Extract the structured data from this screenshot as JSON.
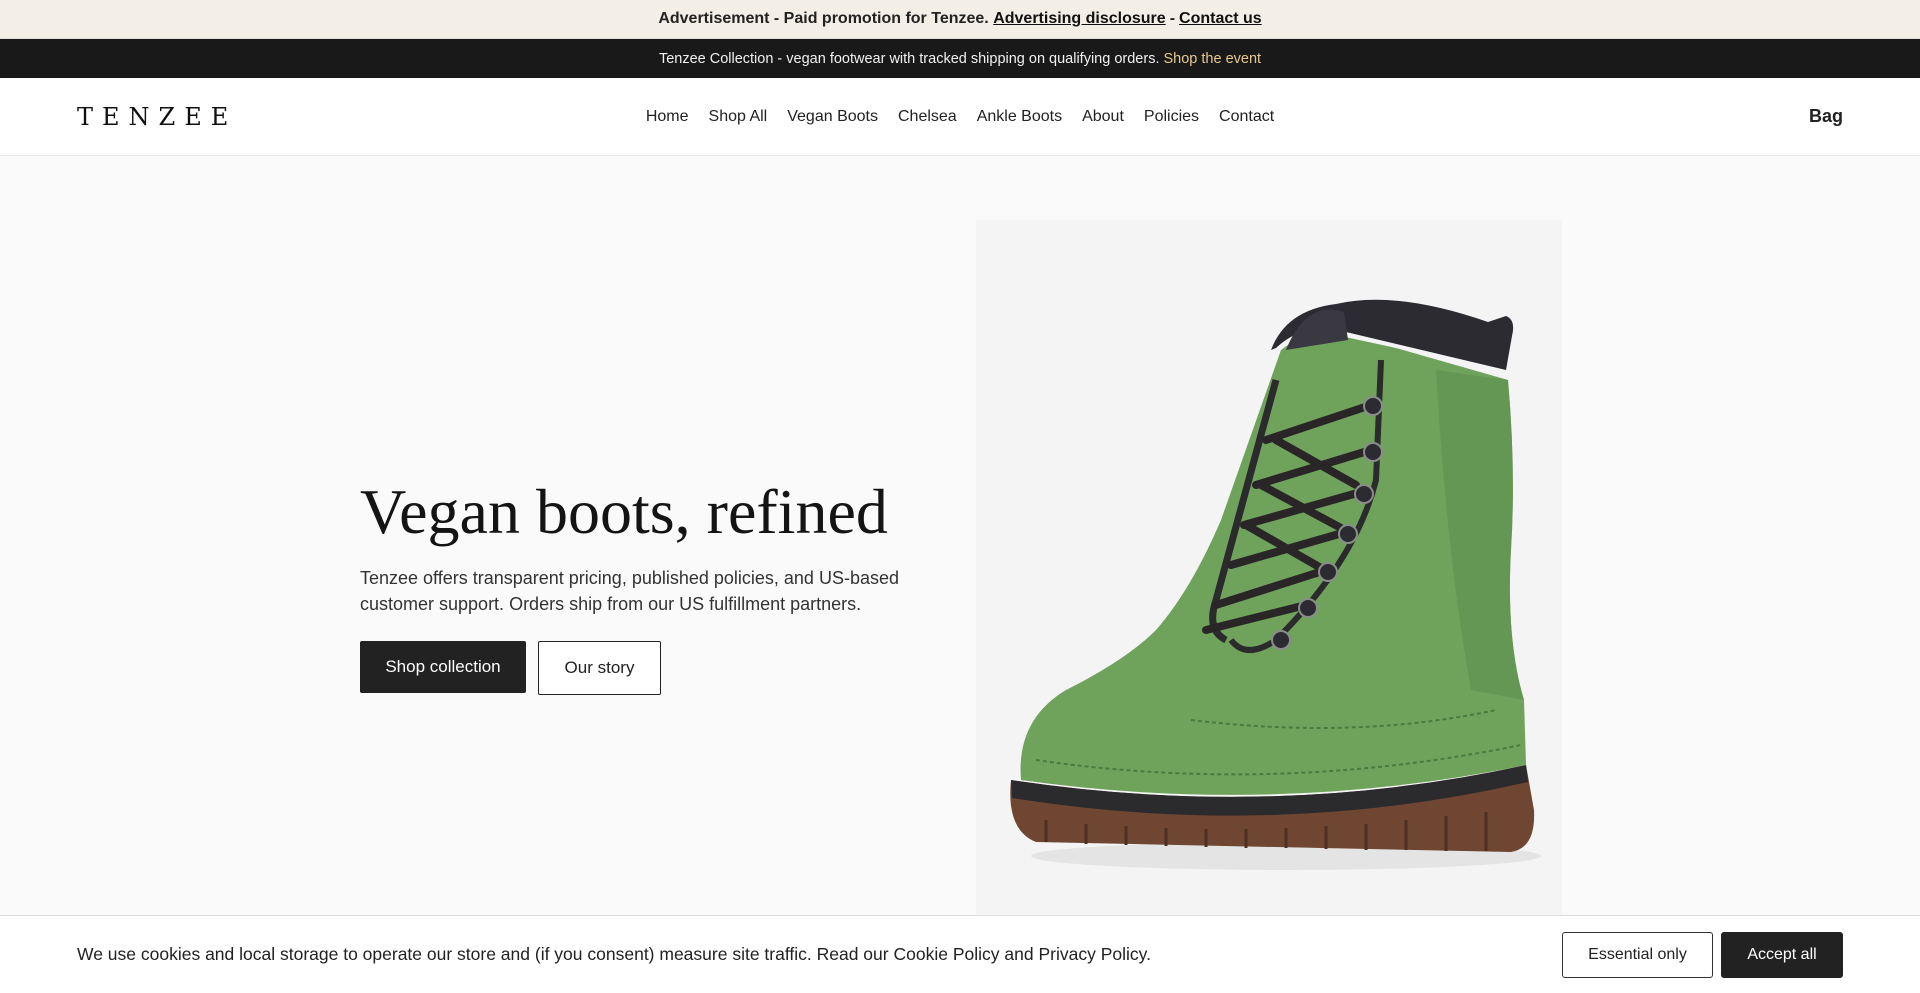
{
  "ad_bar": {
    "text": "Advertisement - Paid promotion for Tenzee.",
    "disclosure_link": "Advertising disclosure",
    "separator": "-",
    "contact_link": "Contact us"
  },
  "promo_bar": {
    "text": "Tenzee Collection - vegan footwear with tracked shipping on qualifying orders.",
    "link": "Shop the event",
    "link_color": "#e6c98f"
  },
  "header": {
    "logo": "TENZEE",
    "nav": [
      "Home",
      "Shop All",
      "Vegan Boots",
      "Chelsea",
      "Ankle Boots",
      "About",
      "Policies",
      "Contact"
    ],
    "bag": "Bag"
  },
  "hero": {
    "title": "Vegan boots, refined",
    "subtitle": "Tenzee offers transparent pricing, published policies, and US-based customer support. Orders ship from our US fulfillment partners.",
    "primary_button": "Shop collection",
    "secondary_button": "Our story",
    "image": {
      "subject": "green vegan leather lace-up boot with brown sole",
      "boot_color": "#6fa35c",
      "sole_color": "#6e4632"
    }
  },
  "cookie_bar": {
    "text_before": "We use cookies and local storage to operate our store and (if you consent) measure site traffic. Read our",
    "cookie_link": "Cookie Policy",
    "and": "and",
    "privacy_link": "Privacy Policy",
    "period": ".",
    "essential_button": "Essential only",
    "accept_button": "Accept all"
  }
}
